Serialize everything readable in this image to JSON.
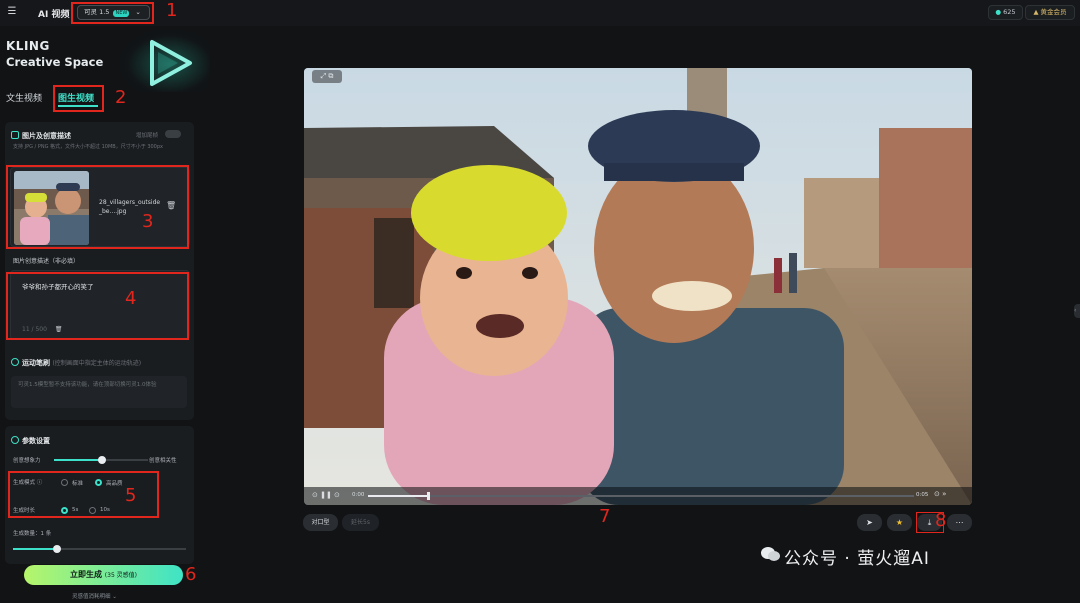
{
  "header": {
    "menu_icon": "menu-icon",
    "app_title": "AI 视频",
    "model_label": "可灵 1.5",
    "model_badge": "NEW",
    "credits": "625",
    "member": "黄金会员"
  },
  "brand": {
    "line1": "KLING",
    "line2": "Creative Space"
  },
  "tabs": [
    {
      "label": "文生视频"
    },
    {
      "label": "图生视频"
    }
  ],
  "image_card": {
    "title": "图片及创意描述",
    "toggle_label": "增加尾帧",
    "hint": "支持 JPG / PNG 格式，文件大小不超过 10MB，尺寸不小于 300px",
    "file_name": "28_villagers_outside_be....jpg",
    "desc_label": "图片创意描述（非必填）",
    "desc_text": "爷爷和孙子都开心的笑了",
    "desc_count": "11 / 500"
  },
  "motion_card": {
    "title": "运动笔刷",
    "subtitle": "(控制画面中指定主体的运动轨迹)",
    "note": "可灵1.5模型暂不支持该功能，请在顶部切换可灵1.0体验"
  },
  "params_card": {
    "title": "参数设置",
    "slider_left": "创意想象力",
    "slider_right": "创意相关性",
    "mode_label": "生成模式",
    "mode_std": "标准",
    "mode_hq": "高品质",
    "duration_label": "生成时长",
    "dur_5": "5s",
    "dur_10": "10s",
    "count_label": "生成数量：1 条"
  },
  "generate": {
    "label": "立即生成",
    "cost": "35 灵感值",
    "cost_link": "灵感值消耗明细"
  },
  "player": {
    "time_start": "0:00",
    "time_end": "0:05",
    "progress": 0.11
  },
  "actions": {
    "compare": "对口型",
    "extend": "延长5s"
  },
  "annotations": [
    "1",
    "2",
    "3",
    "4",
    "5",
    "6",
    "7",
    "8"
  ],
  "watermark": "公众号 · 萤火遛AI",
  "colors": {
    "accent": "#3de0c8",
    "annotation": "#e0261d",
    "bg": "#111315"
  }
}
